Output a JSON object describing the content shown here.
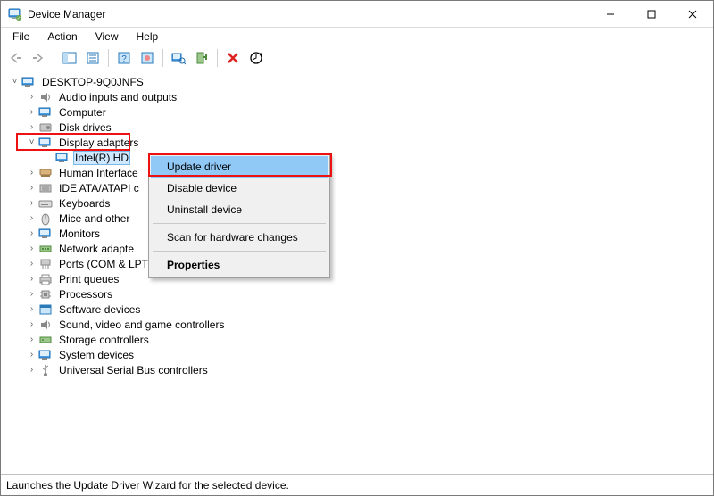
{
  "window": {
    "title": "Device Manager"
  },
  "menubar": {
    "file": "File",
    "action": "Action",
    "view": "View",
    "help": "Help"
  },
  "tree": {
    "root": "DESKTOP-9Q0JNFS",
    "nodes": {
      "audio": "Audio inputs and outputs",
      "computer": "Computer",
      "disk": "Disk drives",
      "display": "Display adapters",
      "display_child": "Intel(R) HD",
      "hid": "Human Interface",
      "ide": "IDE ATA/ATAPI c",
      "keyboards": "Keyboards",
      "mice": "Mice and other",
      "monitors": "Monitors",
      "network": "Network adapte",
      "ports": "Ports (COM & LPT)",
      "print": "Print queues",
      "processors": "Processors",
      "software": "Software devices",
      "sound": "Sound, video and game controllers",
      "storage": "Storage controllers",
      "system": "System devices",
      "usb": "Universal Serial Bus controllers"
    }
  },
  "context_menu": {
    "update": "Update driver",
    "disable": "Disable device",
    "uninstall": "Uninstall device",
    "scan": "Scan for hardware changes",
    "properties": "Properties"
  },
  "statusbar": {
    "text": "Launches the Update Driver Wizard for the selected device."
  }
}
